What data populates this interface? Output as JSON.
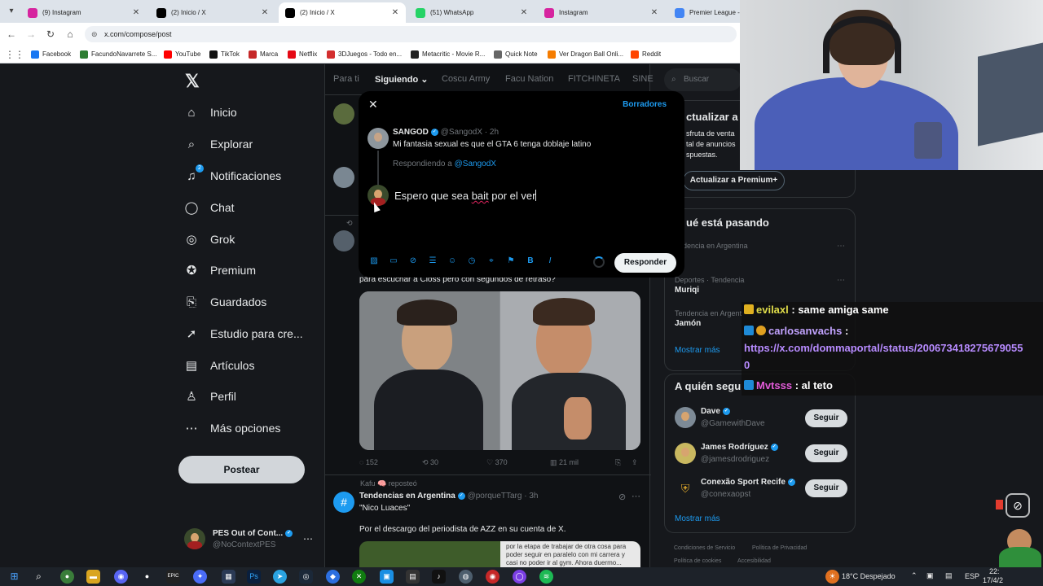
{
  "browser": {
    "tabs": [
      {
        "label": "(9) Instagram",
        "color": "#d6249f"
      },
      {
        "label": "(2) Inicio / X",
        "color": "#000000"
      },
      {
        "label": "(2) Inicio / X",
        "color": "#000000"
      },
      {
        "label": "(51) WhatsApp",
        "color": "#25d366"
      },
      {
        "label": "Instagram",
        "color": "#d6249f"
      },
      {
        "label": "Premier League - B",
        "color": "#4285f4"
      }
    ],
    "url": "x.com/compose/post",
    "bookmarks": [
      {
        "label": "Facebook",
        "color": "#1877f2"
      },
      {
        "label": "FacundoNavarrete S...",
        "color": "#2e7d32"
      },
      {
        "label": "YouTube",
        "color": "#ff0000"
      },
      {
        "label": "TikTok",
        "color": "#111111"
      },
      {
        "label": "Marca",
        "color": "#c62828"
      },
      {
        "label": "Netflix",
        "color": "#e50914"
      },
      {
        "label": "3DJuegos - Todo en...",
        "color": "#d32f2f"
      },
      {
        "label": "Metacritic - Movie R...",
        "color": "#222222"
      },
      {
        "label": "Quick Note",
        "color": "#666666"
      },
      {
        "label": "Ver Dragon Ball Onli...",
        "color": "#f57c00"
      },
      {
        "label": "Reddit",
        "color": "#ff4500"
      }
    ]
  },
  "sidebar": {
    "items": [
      {
        "label": "Inicio",
        "icon": "home-icon",
        "glyph": "⌂"
      },
      {
        "label": "Explorar",
        "icon": "search-icon",
        "glyph": "⌕"
      },
      {
        "label": "Notificaciones",
        "icon": "bell-icon",
        "glyph": "🔔",
        "badge": "2"
      },
      {
        "label": "Chat",
        "icon": "chat-icon",
        "glyph": "◯"
      },
      {
        "label": "Grok",
        "icon": "grok-icon",
        "glyph": "◎"
      },
      {
        "label": "Premium",
        "icon": "premium-icon",
        "glyph": "✪"
      },
      {
        "label": "Guardados",
        "icon": "bookmark-icon",
        "glyph": "⎘"
      },
      {
        "label": "Estudio para cre...",
        "icon": "rocket-icon",
        "glyph": "➚"
      },
      {
        "label": "Artículos",
        "icon": "articles-icon",
        "glyph": "▤"
      },
      {
        "label": "Perfil",
        "icon": "profile-icon",
        "glyph": "♙"
      },
      {
        "label": "Más opciones",
        "icon": "more-icon",
        "glyph": "⋯"
      }
    ],
    "post_label": "Postear",
    "account": {
      "name": "PES Out of Cont...",
      "handle": "@NoContextPES"
    }
  },
  "feed": {
    "tabs": [
      "Para ti",
      "Siguiendo",
      "Coscu Army",
      "Facu Nation",
      "FITCHINETA",
      "SINE"
    ],
    "partial_text": "para escuchar a Closs pero con segundos de retraso?",
    "actions": {
      "replies": "152",
      "reposts": "30",
      "likes": "370",
      "views": "21 mil"
    },
    "repost_note": "Kafu 🧠 reposteó",
    "next_post": {
      "name": "Tendencias en Argentina",
      "handle": "@porqueTTarg",
      "time": "· 3h",
      "quote": "\"Nico Luaces\"",
      "body": "Por el descargo del periodista de AZZ en su cuenta de X.",
      "preview": "por la etapa de trabajar de otra cosa para poder seguir en paralelo con mi carrera y casi no poder ir al gym. Ahora duermo..."
    }
  },
  "right": {
    "search_placeholder": "Buscar",
    "premium": {
      "title": "ctualizar a",
      "body": [
        "sfruta de venta",
        "tal de anuncios",
        "spuestas."
      ],
      "button": "Actualizar a Premium+"
    },
    "trends": {
      "title": "ué está pasando",
      "items": [
        {
          "context": "endencia en Argentina",
          "name": "i"
        },
        {
          "context": "Deportes · Tendencia",
          "name": "Muriqi"
        },
        {
          "context": "Tendencia en Argent",
          "name": "Jamón"
        }
      ],
      "more": "Mostrar más"
    },
    "follow": {
      "title": "A quién segu",
      "users": [
        {
          "name": "Dave",
          "handle": "@GamewithDave"
        },
        {
          "name": "James Rodríguez",
          "handle": "@jamesdrodriguez"
        },
        {
          "name": "Conexão Sport Recife",
          "handle": "@conexaopst"
        }
      ],
      "button": "Seguir",
      "more": "Mostrar más"
    },
    "footer": [
      "Condiciones de Servicio",
      "Política de Privacidad",
      "Política de cookies",
      "Accesibilidad"
    ]
  },
  "modal": {
    "close_icon": "close-icon",
    "drafts": "Borradores",
    "original": {
      "name": "SANGOD",
      "handle": "@SangodX",
      "time": "· 2h",
      "text": "Mi fantasia sexual es que el GTA 6 tenga doblaje latino"
    },
    "replying_prefix": "Respondiendo a",
    "replying_to": "@SangodX",
    "draft_before": "Espero que sea ",
    "draft_misspelled": "bait",
    "draft_after": " por el ver",
    "reply_button": "Responder"
  },
  "chat": {
    "messages": [
      {
        "user": "evilaxl",
        "text": ": same amiga same"
      },
      {
        "user": "carlosanvachs",
        "text": ":"
      },
      {
        "user": "",
        "text": "https://x.com/dommaportal/status/200673418275679055"
      },
      {
        "user": "",
        "text": "0"
      },
      {
        "user": "Mvtsss",
        "text": ": al teto"
      }
    ]
  },
  "taskbar": {
    "weather": "18°C  Despejado",
    "lang": "ESP",
    "time": "22:",
    "date": "17/4/2"
  },
  "colors": {
    "accent": "#1d9bf0",
    "background": "#000000"
  }
}
